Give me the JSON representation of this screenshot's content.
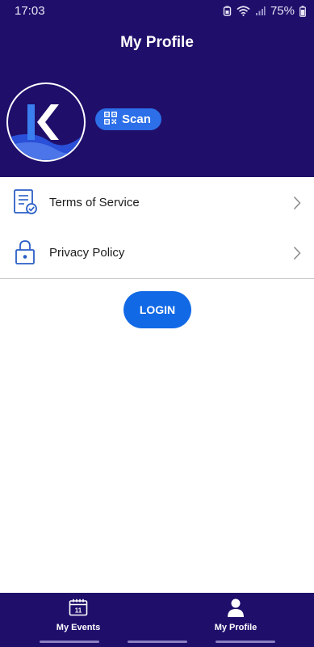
{
  "status_bar": {
    "time": "17:03",
    "battery": "75%"
  },
  "header": {
    "title": "My Profile",
    "avatar_letter": "K"
  },
  "scan": {
    "label": "Scan"
  },
  "menu": {
    "items": [
      {
        "label": "Terms of Service",
        "icon": "document-check-icon"
      },
      {
        "label": "Privacy Policy",
        "icon": "lock-icon"
      }
    ]
  },
  "login": {
    "label": "LOGIN"
  },
  "bottom_nav": {
    "items": [
      {
        "label": "My Events",
        "icon": "calendar-icon",
        "icon_text": "11"
      },
      {
        "label": "My Profile",
        "icon": "person-icon"
      }
    ]
  },
  "colors": {
    "header_bg": "#1f0f6b",
    "accent": "#1169e6",
    "scan_bg": "#2c6fe8"
  }
}
